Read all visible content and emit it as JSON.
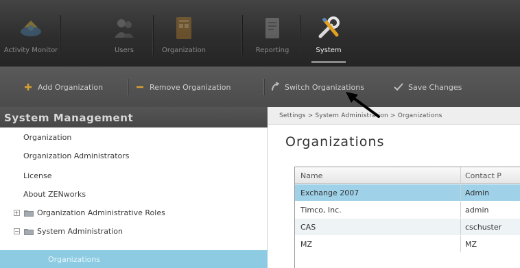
{
  "nav": {
    "items": [
      {
        "label": "Activity Monitor",
        "icon": "activity-monitor-icon"
      },
      {
        "label": "Users",
        "icon": "users-icon"
      },
      {
        "label": "Organization",
        "icon": "organization-icon"
      },
      {
        "label": "Reporting",
        "icon": "reporting-icon"
      },
      {
        "label": "System",
        "icon": "system-tools-icon",
        "active": true
      }
    ]
  },
  "toolbar": {
    "add_label": "Add Organization",
    "remove_label": "Remove Organization",
    "switch_label": "Switch Organizations",
    "save_label": "Save Changes"
  },
  "sidebar": {
    "header": "System Management",
    "items": [
      {
        "label": "Organization"
      },
      {
        "label": "Organization Administrators"
      },
      {
        "label": "License"
      },
      {
        "label": "About ZENworks"
      },
      {
        "label": "Organization Administrative Roles",
        "expander": "+"
      },
      {
        "label": "System Administration",
        "expander": "−"
      },
      {
        "label": "Organizations",
        "selected": true
      }
    ]
  },
  "main": {
    "breadcrumb": "Settings > System Administration > Organizations",
    "title": "Organizations",
    "table": {
      "columns": [
        "Name",
        "Contact P"
      ],
      "rows": [
        {
          "name": "Exchange 2007",
          "contact": "Admin",
          "selected": true
        },
        {
          "name": "Timco, Inc.",
          "contact": "admin"
        },
        {
          "name": "CAS",
          "contact": "cschuster"
        },
        {
          "name": "MZ",
          "contact": "MZ"
        }
      ]
    }
  },
  "colors": {
    "selection": "#9fd1e8",
    "sidebar_selection": "#8ccbe2",
    "nav_bg": "#2e2e2e",
    "toolbar_bg": "#4f4f4f"
  }
}
